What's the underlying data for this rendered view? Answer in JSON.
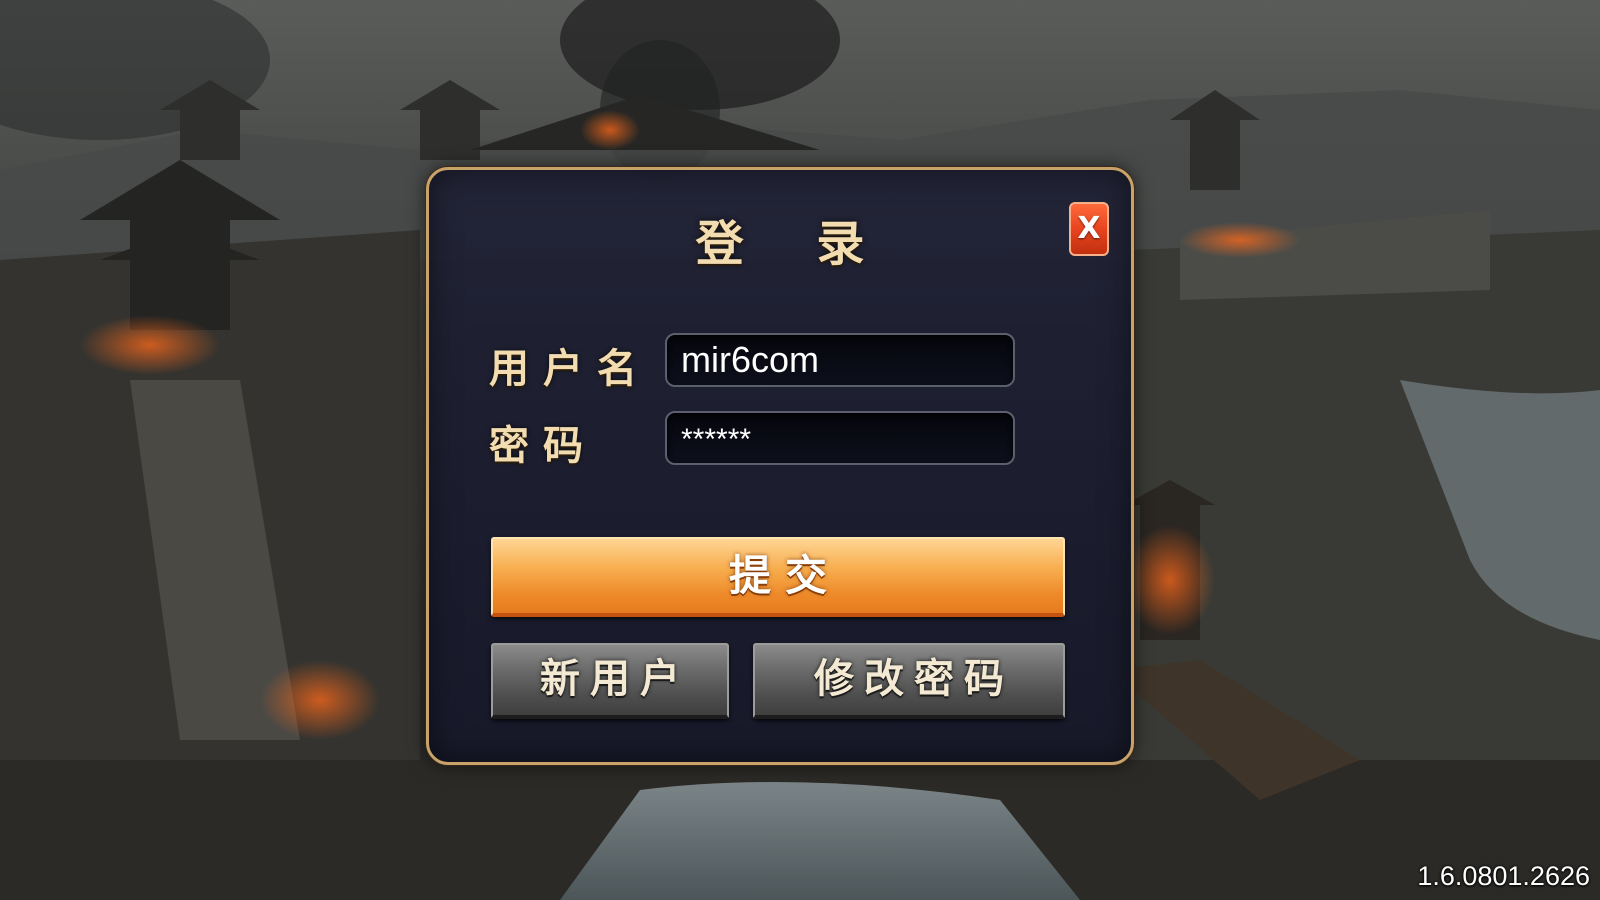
{
  "login_dialog": {
    "title": "登 录",
    "close_label": "X",
    "username_label": "用户名",
    "username_value": "mir6com",
    "password_label": "密码",
    "password_value": "******",
    "submit_label": "提交",
    "new_user_label": "新用户",
    "change_password_label": "修改密码"
  },
  "version": "1.6.0801.2626",
  "colors": {
    "accent_gold": "#c9a26a",
    "submit_orange": "#f7ae4e",
    "close_red": "#e8441f",
    "button_gray": "#6a6b6a",
    "label_cream": "#f2dcb0"
  },
  "icons": {
    "close": "close-icon"
  }
}
